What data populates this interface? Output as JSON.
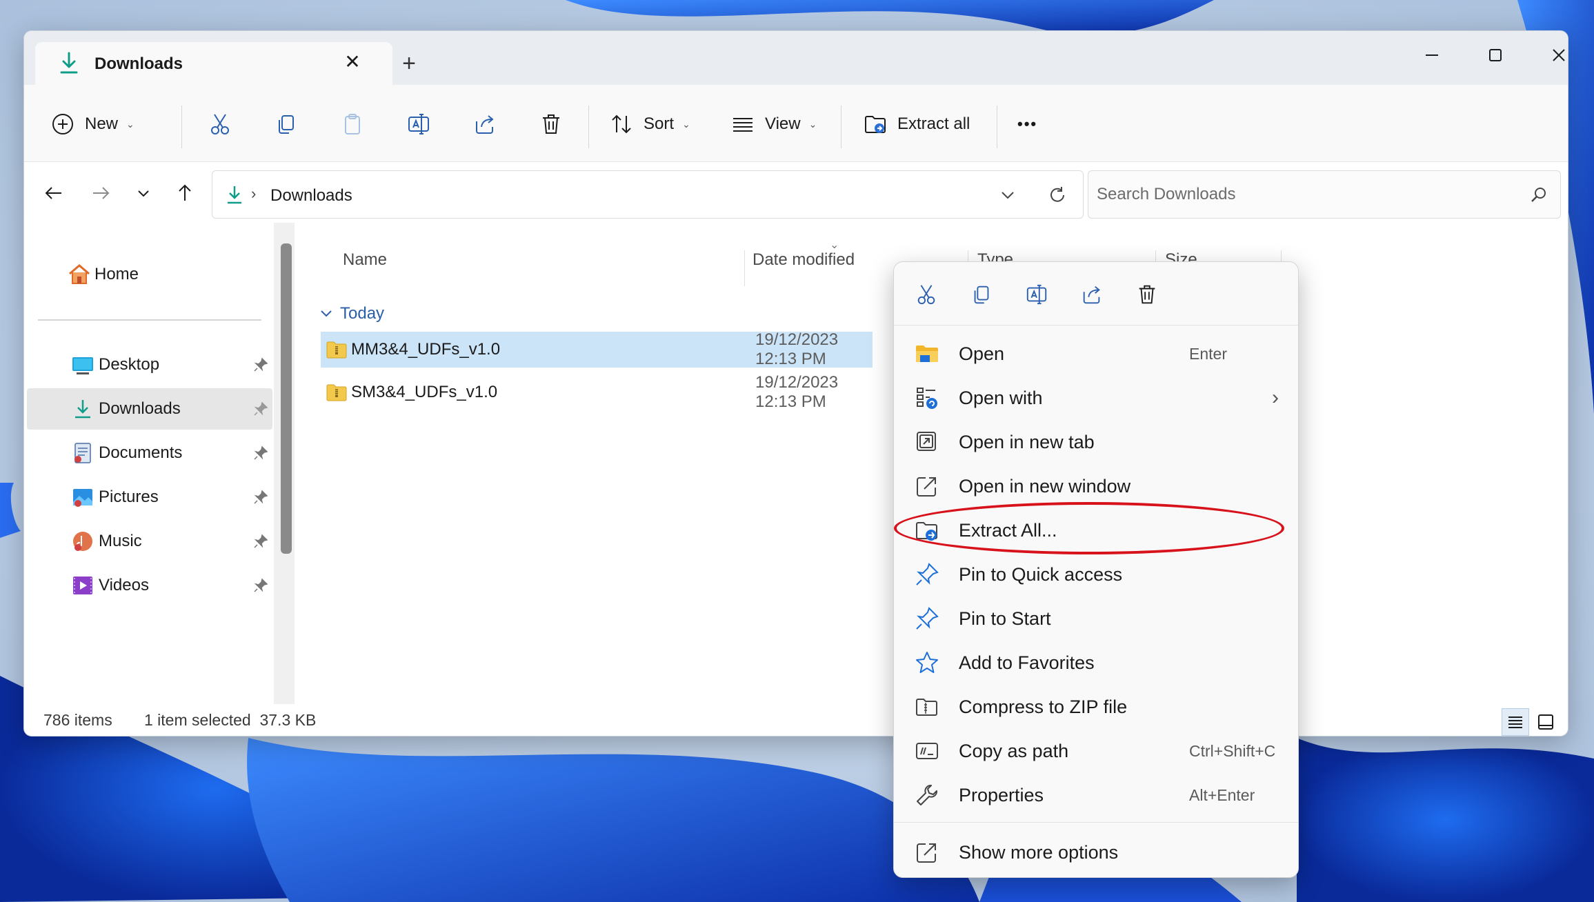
{
  "window": {
    "tab_title": "Downloads",
    "tab_close": "✕",
    "new_tab": "+"
  },
  "toolbar": {
    "new_label": "New",
    "sort_label": "Sort",
    "view_label": "View",
    "extract_label": "Extract all",
    "more_label": "•••"
  },
  "address": {
    "path": "Downloads",
    "search_placeholder": "Search Downloads"
  },
  "sidebar": {
    "home": "Home",
    "items": [
      {
        "label": "Desktop"
      },
      {
        "label": "Downloads"
      },
      {
        "label": "Documents"
      },
      {
        "label": "Pictures"
      },
      {
        "label": "Music"
      },
      {
        "label": "Videos"
      }
    ]
  },
  "columns": {
    "name": "Name",
    "date": "Date modified",
    "type": "Type",
    "size": "Size"
  },
  "group": {
    "label": "Today"
  },
  "files": [
    {
      "name": "MM3&4_UDFs_v1.0",
      "date": "19/12/2023 12:13 PM"
    },
    {
      "name": "SM3&4_UDFs_v1.0",
      "date": "19/12/2023 12:13 PM"
    }
  ],
  "status": {
    "items": "786 items",
    "selected": "1 item selected  37.3 KB"
  },
  "context_menu": {
    "items": [
      {
        "label": "Open",
        "shortcut": "Enter"
      },
      {
        "label": "Open with",
        "shortcut": "›"
      },
      {
        "label": "Open in new tab",
        "shortcut": ""
      },
      {
        "label": "Open in new window",
        "shortcut": ""
      },
      {
        "label": "Extract All...",
        "shortcut": ""
      },
      {
        "label": "Pin to Quick access",
        "shortcut": ""
      },
      {
        "label": "Pin to Start",
        "shortcut": ""
      },
      {
        "label": "Add to Favorites",
        "shortcut": ""
      },
      {
        "label": "Compress to ZIP file",
        "shortcut": ""
      },
      {
        "label": "Copy as path",
        "shortcut": "Ctrl+Shift+C"
      },
      {
        "label": "Properties",
        "shortcut": "Alt+Enter"
      },
      {
        "label": "Show more options",
        "shortcut": ""
      }
    ]
  },
  "colors": {
    "accent": "#0067c0",
    "selection": "#cce4f7",
    "highlight_annotation": "#d8121b",
    "group_text": "#2b5ea8"
  }
}
